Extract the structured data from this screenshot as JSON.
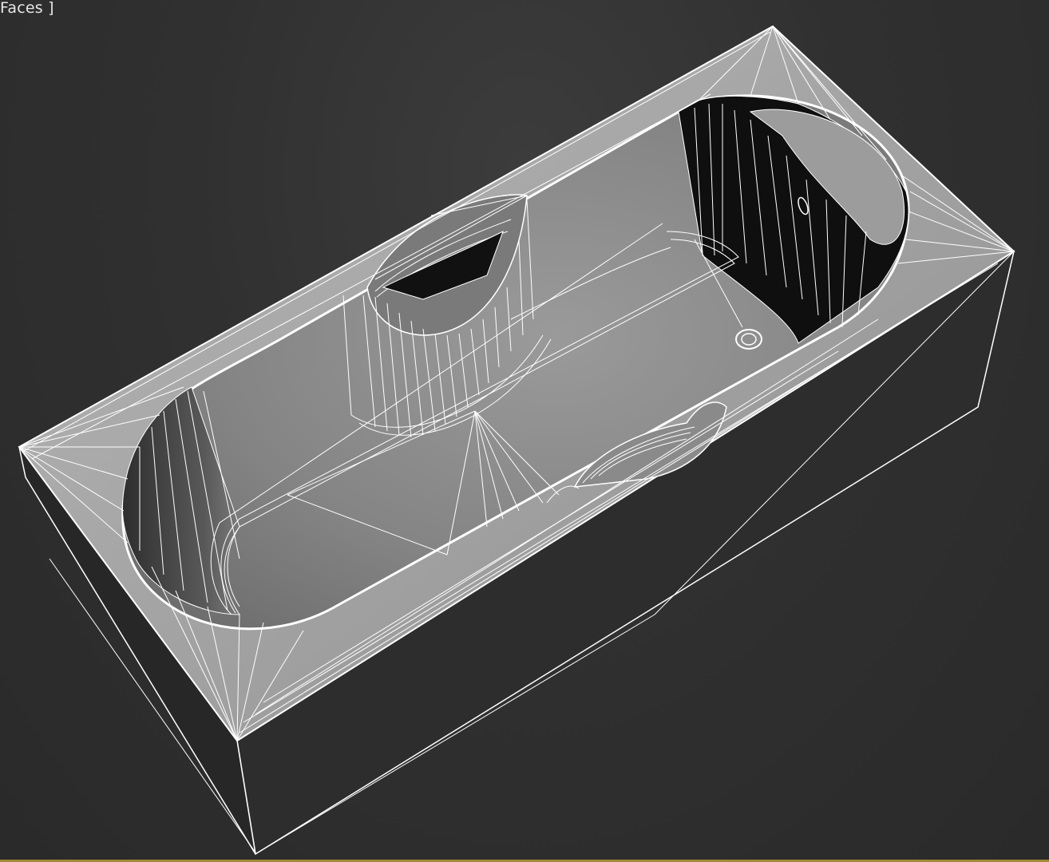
{
  "viewport": {
    "label": "Faces ]",
    "shading": "wireframe-on-shaded",
    "active_border_color": "#a08a3a",
    "background_color": "#2f2f2f",
    "wire_color": "#ffffff",
    "model": "bathtub"
  }
}
